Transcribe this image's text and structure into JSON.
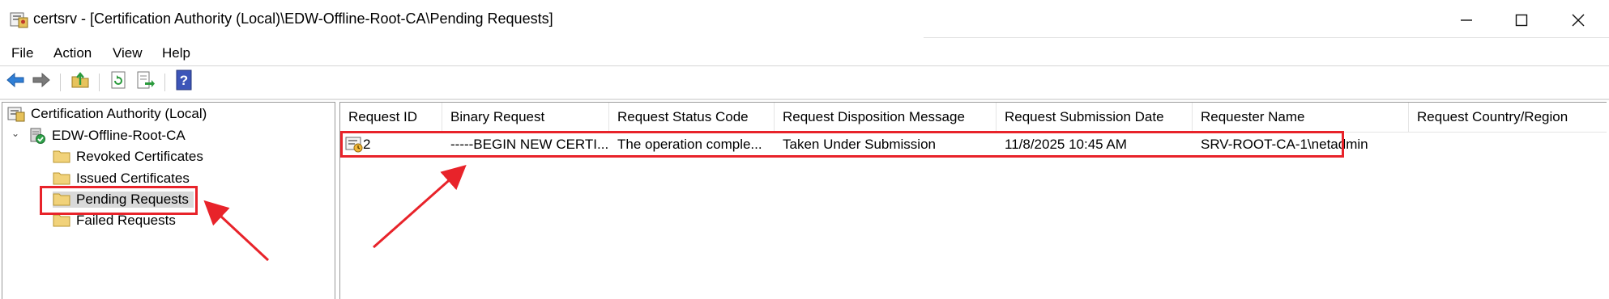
{
  "window": {
    "title": "certsrv - [Certification Authority (Local)\\EDW-Offline-Root-CA\\Pending Requests]",
    "icon": "certsrv-app-icon",
    "controls": [
      "minimize-icon",
      "maximize-icon",
      "close-icon"
    ]
  },
  "menu": {
    "items": [
      {
        "label": "File"
      },
      {
        "label": "Action"
      },
      {
        "label": "View"
      },
      {
        "label": "Help"
      }
    ]
  },
  "toolbar": {
    "buttons": [
      {
        "name": "back-arrow-icon"
      },
      {
        "name": "forward-arrow-icon"
      },
      {
        "name": "up-folder-icon"
      },
      {
        "name": "refresh-icon"
      },
      {
        "name": "export-list-icon"
      },
      {
        "name": "help-icon"
      }
    ]
  },
  "tree": {
    "root": {
      "label": "Certification Authority (Local)",
      "icon": "certificate-authority-icon"
    },
    "ca": {
      "label": "EDW-Offline-Root-CA",
      "icon": "ca-server-check-icon",
      "expander": "⌄"
    },
    "folders": [
      {
        "label": "Revoked Certificates",
        "icon": "folder-icon"
      },
      {
        "label": "Issued Certificates",
        "icon": "folder-icon"
      },
      {
        "label": "Pending Requests",
        "icon": "folder-icon",
        "selected": true
      },
      {
        "label": "Failed Requests",
        "icon": "folder-icon"
      }
    ]
  },
  "list": {
    "columns": [
      {
        "label": "Request ID"
      },
      {
        "label": "Binary Request"
      },
      {
        "label": "Request Status Code"
      },
      {
        "label": "Request Disposition Message"
      },
      {
        "label": "Request Submission Date"
      },
      {
        "label": "Requester Name"
      },
      {
        "label": "Request Country/Region"
      }
    ],
    "rows": [
      {
        "icon": "pending-request-icon",
        "request_id": "2",
        "binary_request": "-----BEGIN NEW CERTI...",
        "status_code": "The operation comple...",
        "disposition": "Taken Under Submission",
        "submission_date": "11/8/2025 10:45 AM",
        "requester": "SRV-ROOT-CA-1\\netadmin",
        "country": ""
      }
    ]
  },
  "annotations": {
    "highlight_color": "#e8232a",
    "highlights": [
      "pending-requests-node",
      "request-row"
    ],
    "arrows": [
      "arrow-to-pending-requests",
      "arrow-to-request-row"
    ]
  }
}
